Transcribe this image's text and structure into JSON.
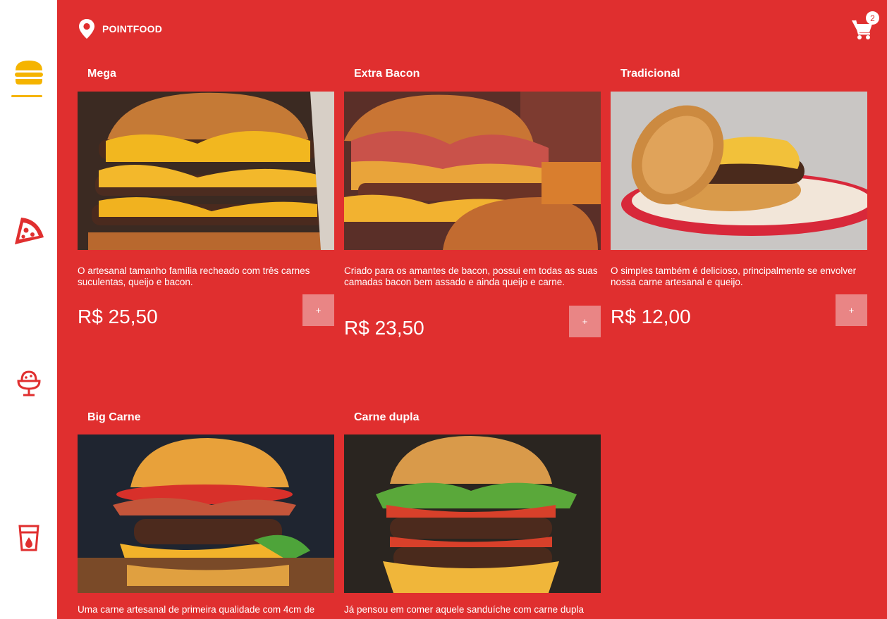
{
  "brand": {
    "name": "POINTFOOD",
    "icon": "location-pin-icon"
  },
  "cart": {
    "count": "2",
    "icon": "cart-icon"
  },
  "sidebar": {
    "items": [
      {
        "name": "burgers",
        "icon": "burger-icon",
        "active": true,
        "color": "#f5b400"
      },
      {
        "name": "pizzas",
        "icon": "pizza-icon",
        "active": false,
        "color": "#e02f2f"
      },
      {
        "name": "desserts",
        "icon": "ice-cream-icon",
        "active": false,
        "color": "#e02f2f"
      },
      {
        "name": "drinks",
        "icon": "drink-cup-icon",
        "active": false,
        "color": "#e02f2f"
      }
    ]
  },
  "products": [
    {
      "title": "Mega",
      "description": "O artesanal tamanho família recheado com três carnes suculentas, queijo e bacon.",
      "price": "R$ 25,50",
      "add_label": "+"
    },
    {
      "title": "Extra Bacon",
      "description": "Criado para os amantes de bacon, possui em todas as suas camadas bacon bem assado e ainda queijo e carne.",
      "price": "R$ 23,50",
      "add_label": "+"
    },
    {
      "title": "Tradicional",
      "description": "O simples também é delicioso, principalmente se envolver nossa carne artesanal e queijo.",
      "price": "R$ 12,00",
      "add_label": "+"
    },
    {
      "title": "Big Carne",
      "description": "Uma carne artesanal de primeira qualidade com 4cm de",
      "price": "",
      "add_label": "+"
    },
    {
      "title": "Carne dupla",
      "description": "Já pensou em comer aquele sanduíche com carne dupla",
      "price": "",
      "add_label": "+"
    }
  ],
  "colors": {
    "accent": "#e02f2f",
    "active": "#f5b400",
    "button": "#e98585"
  }
}
